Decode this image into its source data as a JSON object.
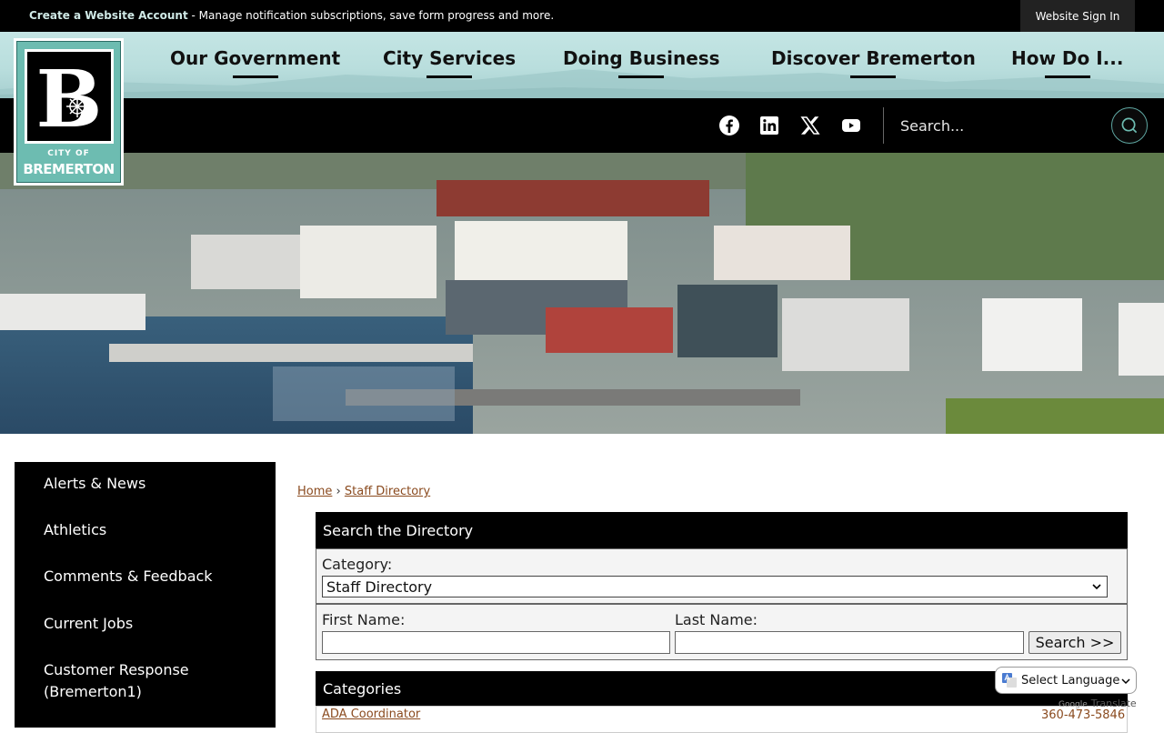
{
  "topbar": {
    "account_link": "Create a Website Account",
    "account_message": " - Manage notification subscriptions, save form progress and more.",
    "signin_label": "Website Sign In"
  },
  "logo": {
    "letter": "B",
    "city_of": "CITY OF",
    "name": "BREMERTON"
  },
  "nav": {
    "items": [
      {
        "label": "Our Government"
      },
      {
        "label": "City Services"
      },
      {
        "label": "Doing Business"
      },
      {
        "label": "Discover Bremerton"
      },
      {
        "label": "How Do I..."
      }
    ]
  },
  "social": [
    "facebook-icon",
    "linkedin-icon",
    "x-icon",
    "youtube-icon"
  ],
  "search": {
    "placeholder": "Search..."
  },
  "sidebar": {
    "items": [
      {
        "label": "Alerts & News"
      },
      {
        "label": "Athletics"
      },
      {
        "label": "Comments & Feedback"
      },
      {
        "label": "Current Jobs"
      },
      {
        "label": "Customer Response"
      },
      {
        "label": "(Bremerton1)"
      }
    ]
  },
  "breadcrumb": {
    "home": "Home",
    "separator": "›",
    "current": "Staff Directory"
  },
  "directory": {
    "title": "Search the Directory",
    "category_label": "Category:",
    "category_value": "Staff Directory",
    "first_name_label": "First Name:",
    "last_name_label": "Last Name:",
    "search_button": "Search >>"
  },
  "categories": {
    "title": "Categories",
    "rows": [
      {
        "name": "ADA Coordinator",
        "phone": "360-473-5846"
      }
    ]
  },
  "translate": {
    "label": "Select Language",
    "powered_by": "Google",
    "translate_word": "Translate"
  },
  "colors": {
    "accent": "#6dbcb1",
    "link": "#8a4a1e",
    "nav_bg": "#c4e5e4"
  }
}
